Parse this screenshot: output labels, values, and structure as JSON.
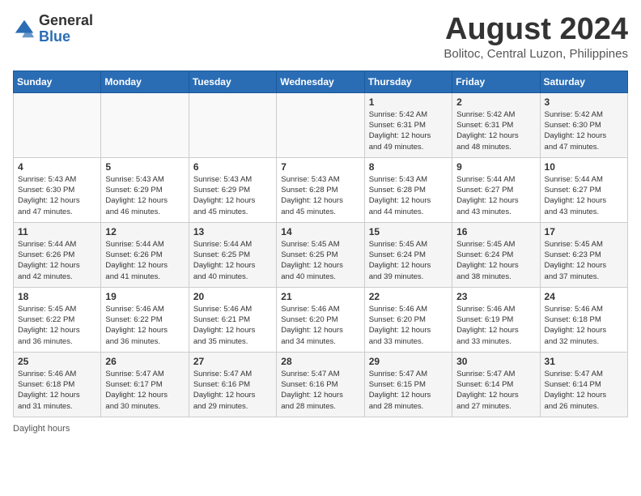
{
  "header": {
    "logo_general": "General",
    "logo_blue": "Blue",
    "title": "August 2024",
    "subtitle": "Bolitoc, Central Luzon, Philippines"
  },
  "days_of_week": [
    "Sunday",
    "Monday",
    "Tuesday",
    "Wednesday",
    "Thursday",
    "Friday",
    "Saturday"
  ],
  "weeks": [
    [
      {
        "day": "",
        "info": ""
      },
      {
        "day": "",
        "info": ""
      },
      {
        "day": "",
        "info": ""
      },
      {
        "day": "",
        "info": ""
      },
      {
        "day": "1",
        "info": "Sunrise: 5:42 AM\nSunset: 6:31 PM\nDaylight: 12 hours\nand 49 minutes."
      },
      {
        "day": "2",
        "info": "Sunrise: 5:42 AM\nSunset: 6:31 PM\nDaylight: 12 hours\nand 48 minutes."
      },
      {
        "day": "3",
        "info": "Sunrise: 5:42 AM\nSunset: 6:30 PM\nDaylight: 12 hours\nand 47 minutes."
      }
    ],
    [
      {
        "day": "4",
        "info": "Sunrise: 5:43 AM\nSunset: 6:30 PM\nDaylight: 12 hours\nand 47 minutes."
      },
      {
        "day": "5",
        "info": "Sunrise: 5:43 AM\nSunset: 6:29 PM\nDaylight: 12 hours\nand 46 minutes."
      },
      {
        "day": "6",
        "info": "Sunrise: 5:43 AM\nSunset: 6:29 PM\nDaylight: 12 hours\nand 45 minutes."
      },
      {
        "day": "7",
        "info": "Sunrise: 5:43 AM\nSunset: 6:28 PM\nDaylight: 12 hours\nand 45 minutes."
      },
      {
        "day": "8",
        "info": "Sunrise: 5:43 AM\nSunset: 6:28 PM\nDaylight: 12 hours\nand 44 minutes."
      },
      {
        "day": "9",
        "info": "Sunrise: 5:44 AM\nSunset: 6:27 PM\nDaylight: 12 hours\nand 43 minutes."
      },
      {
        "day": "10",
        "info": "Sunrise: 5:44 AM\nSunset: 6:27 PM\nDaylight: 12 hours\nand 43 minutes."
      }
    ],
    [
      {
        "day": "11",
        "info": "Sunrise: 5:44 AM\nSunset: 6:26 PM\nDaylight: 12 hours\nand 42 minutes."
      },
      {
        "day": "12",
        "info": "Sunrise: 5:44 AM\nSunset: 6:26 PM\nDaylight: 12 hours\nand 41 minutes."
      },
      {
        "day": "13",
        "info": "Sunrise: 5:44 AM\nSunset: 6:25 PM\nDaylight: 12 hours\nand 40 minutes."
      },
      {
        "day": "14",
        "info": "Sunrise: 5:45 AM\nSunset: 6:25 PM\nDaylight: 12 hours\nand 40 minutes."
      },
      {
        "day": "15",
        "info": "Sunrise: 5:45 AM\nSunset: 6:24 PM\nDaylight: 12 hours\nand 39 minutes."
      },
      {
        "day": "16",
        "info": "Sunrise: 5:45 AM\nSunset: 6:24 PM\nDaylight: 12 hours\nand 38 minutes."
      },
      {
        "day": "17",
        "info": "Sunrise: 5:45 AM\nSunset: 6:23 PM\nDaylight: 12 hours\nand 37 minutes."
      }
    ],
    [
      {
        "day": "18",
        "info": "Sunrise: 5:45 AM\nSunset: 6:22 PM\nDaylight: 12 hours\nand 36 minutes."
      },
      {
        "day": "19",
        "info": "Sunrise: 5:46 AM\nSunset: 6:22 PM\nDaylight: 12 hours\nand 36 minutes."
      },
      {
        "day": "20",
        "info": "Sunrise: 5:46 AM\nSunset: 6:21 PM\nDaylight: 12 hours\nand 35 minutes."
      },
      {
        "day": "21",
        "info": "Sunrise: 5:46 AM\nSunset: 6:20 PM\nDaylight: 12 hours\nand 34 minutes."
      },
      {
        "day": "22",
        "info": "Sunrise: 5:46 AM\nSunset: 6:20 PM\nDaylight: 12 hours\nand 33 minutes."
      },
      {
        "day": "23",
        "info": "Sunrise: 5:46 AM\nSunset: 6:19 PM\nDaylight: 12 hours\nand 33 minutes."
      },
      {
        "day": "24",
        "info": "Sunrise: 5:46 AM\nSunset: 6:18 PM\nDaylight: 12 hours\nand 32 minutes."
      }
    ],
    [
      {
        "day": "25",
        "info": "Sunrise: 5:46 AM\nSunset: 6:18 PM\nDaylight: 12 hours\nand 31 minutes."
      },
      {
        "day": "26",
        "info": "Sunrise: 5:47 AM\nSunset: 6:17 PM\nDaylight: 12 hours\nand 30 minutes."
      },
      {
        "day": "27",
        "info": "Sunrise: 5:47 AM\nSunset: 6:16 PM\nDaylight: 12 hours\nand 29 minutes."
      },
      {
        "day": "28",
        "info": "Sunrise: 5:47 AM\nSunset: 6:16 PM\nDaylight: 12 hours\nand 28 minutes."
      },
      {
        "day": "29",
        "info": "Sunrise: 5:47 AM\nSunset: 6:15 PM\nDaylight: 12 hours\nand 28 minutes."
      },
      {
        "day": "30",
        "info": "Sunrise: 5:47 AM\nSunset: 6:14 PM\nDaylight: 12 hours\nand 27 minutes."
      },
      {
        "day": "31",
        "info": "Sunrise: 5:47 AM\nSunset: 6:14 PM\nDaylight: 12 hours\nand 26 minutes."
      }
    ]
  ],
  "footer": {
    "daylight_label": "Daylight hours"
  },
  "colors": {
    "header_bg": "#2a6db5",
    "logo_blue": "#2a6db5"
  }
}
